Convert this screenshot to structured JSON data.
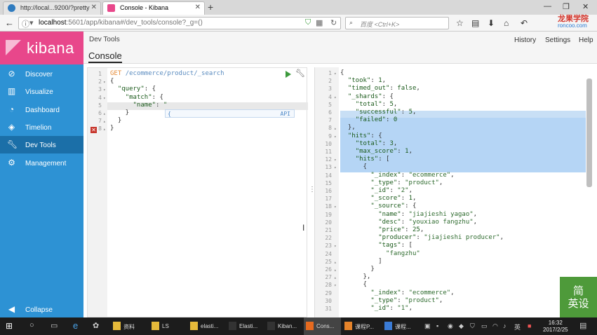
{
  "browser": {
    "tabs": [
      {
        "title": "http://local...9200/?pretty"
      },
      {
        "title": "Console - Kibana"
      }
    ],
    "new_tab": "+",
    "url_host": "localhost",
    "url_path": ":5601/app/kibana#/dev_tools/console?_g=()",
    "search_placeholder": "百度 <Ctrl+K>",
    "logo_cn": "龙果学院",
    "logo_en": "roncoo.com"
  },
  "sidebar": {
    "brand": "kibana",
    "items": [
      {
        "label": "Discover",
        "icon": "compass-icon"
      },
      {
        "label": "Visualize",
        "icon": "bar-chart-icon"
      },
      {
        "label": "Dashboard",
        "icon": "dashboard-icon"
      },
      {
        "label": "Timelion",
        "icon": "timelion-icon"
      },
      {
        "label": "Dev Tools",
        "icon": "wrench-icon"
      },
      {
        "label": "Management",
        "icon": "gear-icon"
      }
    ],
    "collapse": "Collapse"
  },
  "header": {
    "section": "Dev Tools",
    "tab": "Console",
    "links": [
      "History",
      "Settings",
      "Help"
    ]
  },
  "editor": {
    "lines": [
      {
        "n": "1",
        "fold": "",
        "parts": [
          [
            "k-method",
            "GET "
          ],
          [
            "k-path",
            "/ecommerce/product/_search"
          ]
        ]
      },
      {
        "n": "2",
        "fold": "▾",
        "parts": [
          [
            "",
            "{"
          ]
        ]
      },
      {
        "n": "3",
        "fold": "▾",
        "parts": [
          [
            "",
            "  "
          ],
          [
            "k-key",
            "\"query\""
          ],
          [
            "",
            ": {"
          ]
        ]
      },
      {
        "n": "4",
        "fold": "▾",
        "parts": [
          [
            "",
            "    "
          ],
          [
            "k-key",
            "\"match\""
          ],
          [
            "",
            ": {"
          ]
        ]
      },
      {
        "n": "5",
        "fold": "",
        "parts": [
          [
            "",
            "      "
          ],
          [
            "k-key",
            "\"name\""
          ],
          [
            "",
            ": "
          ],
          [
            "k-str",
            "\""
          ]
        ]
      },
      {
        "n": "6",
        "fold": "▴",
        "parts": [
          [
            "",
            "    }"
          ]
        ]
      },
      {
        "n": "7",
        "fold": "▴",
        "parts": [
          [
            "",
            "  }"
          ]
        ]
      },
      {
        "n": "8",
        "fold": "▴",
        "parts": [
          [
            "",
            "}"
          ]
        ]
      }
    ],
    "autocomplete_item": "{",
    "autocomplete_tag": "API"
  },
  "results": {
    "lines": [
      {
        "n": "1",
        "fold": "▾",
        "parts": [
          [
            "",
            "{"
          ]
        ]
      },
      {
        "n": "2",
        "fold": "",
        "parts": [
          [
            "",
            "  "
          ],
          [
            "k-key",
            "\"took\""
          ],
          [
            "",
            ": "
          ],
          [
            "k-num",
            "1"
          ],
          [
            "",
            ","
          ]
        ]
      },
      {
        "n": "3",
        "fold": "",
        "parts": [
          [
            "",
            "  "
          ],
          [
            "k-key",
            "\"timed_out\""
          ],
          [
            "",
            ": "
          ],
          [
            "k-kw",
            "false"
          ],
          [
            "",
            ","
          ]
        ]
      },
      {
        "n": "4",
        "fold": "▾",
        "parts": [
          [
            "",
            "  "
          ],
          [
            "k-key",
            "\"_shards\""
          ],
          [
            "",
            ": {"
          ]
        ]
      },
      {
        "n": "5",
        "fold": "",
        "parts": [
          [
            "",
            "    "
          ],
          [
            "k-key",
            "\"total\""
          ],
          [
            "",
            ": "
          ],
          [
            "k-num",
            "5"
          ],
          [
            "",
            ","
          ]
        ]
      },
      {
        "n": "6",
        "fold": "",
        "parts": [
          [
            "",
            "    "
          ],
          [
            "k-key",
            "\"successful\""
          ],
          [
            "",
            ": "
          ],
          [
            "k-num",
            "5"
          ],
          [
            "",
            ","
          ]
        ]
      },
      {
        "n": "7",
        "fold": "",
        "parts": [
          [
            "",
            "    "
          ],
          [
            "k-key",
            "\"failed\""
          ],
          [
            "",
            ": "
          ],
          [
            "k-num",
            "0"
          ]
        ]
      },
      {
        "n": "8",
        "fold": "▴",
        "parts": [
          [
            "",
            "  },"
          ]
        ]
      },
      {
        "n": "9",
        "fold": "▾",
        "parts": [
          [
            "",
            "  "
          ],
          [
            "k-key",
            "\"hits\""
          ],
          [
            "",
            ": {"
          ]
        ]
      },
      {
        "n": "10",
        "fold": "",
        "parts": [
          [
            "",
            "    "
          ],
          [
            "k-key",
            "\"total\""
          ],
          [
            "",
            ": "
          ],
          [
            "k-num",
            "3"
          ],
          [
            "",
            ","
          ]
        ]
      },
      {
        "n": "11",
        "fold": "",
        "parts": [
          [
            "",
            "    "
          ],
          [
            "k-key",
            "\"max_score\""
          ],
          [
            "",
            ": "
          ],
          [
            "k-num",
            "1"
          ],
          [
            "",
            ","
          ]
        ]
      },
      {
        "n": "12",
        "fold": "▾",
        "parts": [
          [
            "",
            "    "
          ],
          [
            "k-key",
            "\"hits\""
          ],
          [
            "",
            ": ["
          ]
        ]
      },
      {
        "n": "13",
        "fold": "▾",
        "parts": [
          [
            "",
            "      {"
          ]
        ]
      },
      {
        "n": "14",
        "fold": "",
        "parts": [
          [
            "",
            "        "
          ],
          [
            "k-key",
            "\"_index\""
          ],
          [
            "",
            ": "
          ],
          [
            "k-str",
            "\"ecommerce\""
          ],
          [
            "",
            ","
          ]
        ]
      },
      {
        "n": "15",
        "fold": "",
        "parts": [
          [
            "",
            "        "
          ],
          [
            "k-key",
            "\"_type\""
          ],
          [
            "",
            ": "
          ],
          [
            "k-str",
            "\"product\""
          ],
          [
            "",
            ","
          ]
        ]
      },
      {
        "n": "16",
        "fold": "",
        "parts": [
          [
            "",
            "        "
          ],
          [
            "k-key",
            "\"_id\""
          ],
          [
            "",
            ": "
          ],
          [
            "k-str",
            "\"2\""
          ],
          [
            "",
            ","
          ]
        ]
      },
      {
        "n": "17",
        "fold": "",
        "parts": [
          [
            "",
            "        "
          ],
          [
            "k-key",
            "\"_score\""
          ],
          [
            "",
            ": "
          ],
          [
            "k-num",
            "1"
          ],
          [
            "",
            ","
          ]
        ]
      },
      {
        "n": "18",
        "fold": "▾",
        "parts": [
          [
            "",
            "        "
          ],
          [
            "k-key",
            "\"_source\""
          ],
          [
            "",
            ": {"
          ]
        ]
      },
      {
        "n": "19",
        "fold": "",
        "parts": [
          [
            "",
            "          "
          ],
          [
            "k-key",
            "\"name\""
          ],
          [
            "",
            ": "
          ],
          [
            "k-str",
            "\"jiajieshi yagao\""
          ],
          [
            "",
            ","
          ]
        ]
      },
      {
        "n": "20",
        "fold": "",
        "parts": [
          [
            "",
            "          "
          ],
          [
            "k-key",
            "\"desc\""
          ],
          [
            "",
            ": "
          ],
          [
            "k-str",
            "\"youxiao fangzhu\""
          ],
          [
            "",
            ","
          ]
        ]
      },
      {
        "n": "21",
        "fold": "",
        "parts": [
          [
            "",
            "          "
          ],
          [
            "k-key",
            "\"price\""
          ],
          [
            "",
            ": "
          ],
          [
            "k-num",
            "25"
          ],
          [
            "",
            ","
          ]
        ]
      },
      {
        "n": "22",
        "fold": "",
        "parts": [
          [
            "",
            "          "
          ],
          [
            "k-key",
            "\"producer\""
          ],
          [
            "",
            ": "
          ],
          [
            "k-str",
            "\"jiajieshi producer\""
          ],
          [
            "",
            ","
          ]
        ]
      },
      {
        "n": "23",
        "fold": "▾",
        "parts": [
          [
            "",
            "          "
          ],
          [
            "k-key",
            "\"tags\""
          ],
          [
            "",
            ": ["
          ]
        ]
      },
      {
        "n": "24",
        "fold": "",
        "parts": [
          [
            "",
            "            "
          ],
          [
            "k-str",
            "\"fangzhu\""
          ]
        ]
      },
      {
        "n": "25",
        "fold": "▴",
        "parts": [
          [
            "",
            "          ]"
          ]
        ]
      },
      {
        "n": "26",
        "fold": "▴",
        "parts": [
          [
            "",
            "        }"
          ]
        ]
      },
      {
        "n": "27",
        "fold": "▴",
        "parts": [
          [
            "",
            "      },"
          ]
        ]
      },
      {
        "n": "28",
        "fold": "▾",
        "parts": [
          [
            "",
            "      {"
          ]
        ]
      },
      {
        "n": "29",
        "fold": "",
        "parts": [
          [
            "",
            "        "
          ],
          [
            "k-key",
            "\"_index\""
          ],
          [
            "",
            ": "
          ],
          [
            "k-str",
            "\"ecommerce\""
          ],
          [
            "",
            ","
          ]
        ]
      },
      {
        "n": "30",
        "fold": "",
        "parts": [
          [
            "",
            "        "
          ],
          [
            "k-key",
            "\"_type\""
          ],
          [
            "",
            ": "
          ],
          [
            "k-str",
            "\"product\""
          ],
          [
            "",
            ","
          ]
        ]
      },
      {
        "n": "31",
        "fold": "",
        "parts": [
          [
            "",
            "        "
          ],
          [
            "k-key",
            "\"_id\""
          ],
          [
            "",
            ": "
          ],
          [
            "k-str",
            "\"1\""
          ],
          [
            "",
            ","
          ]
        ]
      }
    ]
  },
  "watermark": "简\n英设",
  "taskbar": {
    "items": [
      {
        "label": "资料",
        "color": "#e5b93a"
      },
      {
        "label": "LS",
        "color": "#e5b93a"
      },
      {
        "label": "elasti...",
        "color": "#e5b93a"
      },
      {
        "label": "Elasti...",
        "color": "#333"
      },
      {
        "label": "Kiban...",
        "color": "#333"
      },
      {
        "label": "Cons...",
        "color": "#e66a1f"
      },
      {
        "label": "课程P...",
        "color": "#e5832a"
      },
      {
        "label": "课程...",
        "color": "#3a7bd5"
      }
    ],
    "time": "16:32",
    "date": "2017/2/25",
    "ime": "英"
  }
}
